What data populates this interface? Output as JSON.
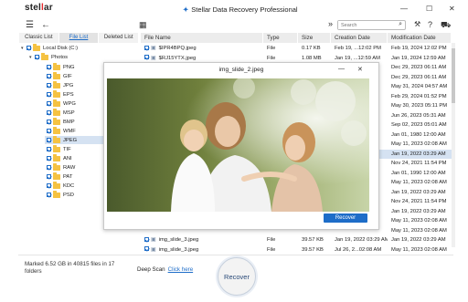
{
  "app": {
    "logo_text": "stellar",
    "title": "Stellar Data Recovery Professional",
    "window_controls": [
      "—",
      "☐",
      "✕"
    ]
  },
  "toolbar": {
    "menu_icon": "hamburger-icon",
    "back_icon": "back-arrow-icon",
    "view_icon": "grid-view-icon",
    "expand_icon": "double-chevron-icon",
    "search_placeholder": "Search",
    "right_icons": [
      "magnifier-icon",
      "wrench-icon",
      "help-icon",
      "cart-icon"
    ]
  },
  "left_tabs": [
    "Classic List",
    "File List",
    "Deleted List"
  ],
  "active_tab": "File List",
  "tree": [
    {
      "label": "Local Disk (C:)",
      "level": 0,
      "type": "drive"
    },
    {
      "label": "Photos",
      "level": 1,
      "type": "folder"
    },
    {
      "label": "PNG",
      "level": 2
    },
    {
      "label": "GIF",
      "level": 2
    },
    {
      "label": "JPG",
      "level": 2
    },
    {
      "label": "EPS",
      "level": 2
    },
    {
      "label": "WPG",
      "level": 2
    },
    {
      "label": "MSP",
      "level": 2
    },
    {
      "label": "BMP",
      "level": 2
    },
    {
      "label": "WMF",
      "level": 2
    },
    {
      "label": "JPEG",
      "level": 2,
      "selected": true
    },
    {
      "label": "TIF",
      "level": 2
    },
    {
      "label": "ANI",
      "level": 2
    },
    {
      "label": "RAW",
      "level": 2
    },
    {
      "label": "PAT",
      "level": 2
    },
    {
      "label": "KDC",
      "level": 2
    },
    {
      "label": "PSD",
      "level": 2
    }
  ],
  "table": {
    "columns": [
      "File Name",
      "Type",
      "Size",
      "Creation Date",
      "Modification Date"
    ],
    "rows": [
      {
        "name": "$IPR4BPQ.jpeg",
        "type": "File",
        "size": "0.17 KB",
        "created": "Feb 19, ...12:02 PM",
        "modified": "Feb 19, 2024 12:02 PM"
      },
      {
        "name": "$RJ15YTX.jpeg",
        "type": "File",
        "size": "1.08 MB",
        "created": "Jan 19, ...12:59 AM",
        "modified": "Jan 19, 2024 12:59 AM"
      },
      {
        "name": "",
        "type": "",
        "size": "",
        "created": "",
        "modified": "Dec 29, 2023 06:11 AM"
      },
      {
        "name": "",
        "type": "",
        "size": "",
        "created": "",
        "modified": "Dec 29, 2023 06:11 AM"
      },
      {
        "name": "",
        "type": "",
        "size": "",
        "created": "",
        "modified": "May 31, 2024 04:57 AM"
      },
      {
        "name": "",
        "type": "",
        "size": "",
        "created": "",
        "modified": "Feb 29, 2024 01:52 PM"
      },
      {
        "name": "",
        "type": "",
        "size": "",
        "created": "",
        "modified": "May 30, 2023 05:11 PM"
      },
      {
        "name": "",
        "type": "",
        "size": "",
        "created": "",
        "modified": "Jun 26, 2023 05:31 AM"
      },
      {
        "name": "",
        "type": "",
        "size": "",
        "created": "",
        "modified": "Sep 02, 2023 05:01 AM"
      },
      {
        "name": "",
        "type": "",
        "size": "",
        "created": "",
        "modified": "Jan 01, 1980 12:00 AM"
      },
      {
        "name": "",
        "type": "",
        "size": "",
        "created": "",
        "modified": "May 11, 2023 02:08 AM"
      },
      {
        "name": "",
        "type": "",
        "size": "",
        "created": "",
        "modified": "Jan 19, 2022 03:29 AM"
      },
      {
        "name": "",
        "type": "",
        "size": "",
        "created": "",
        "modified": "Nov 24, 2021 11:54 PM"
      },
      {
        "name": "",
        "type": "",
        "size": "",
        "created": "",
        "modified": "Jan 01, 1990 12:00 AM"
      },
      {
        "name": "",
        "type": "",
        "size": "",
        "created": "",
        "modified": "May 11, 2023 02:08 AM"
      },
      {
        "name": "",
        "type": "",
        "size": "",
        "created": "",
        "modified": "Jan 19, 2022 03:29 AM"
      },
      {
        "name": "",
        "type": "",
        "size": "",
        "created": "",
        "modified": "Nov 24, 2021 11:54 PM"
      },
      {
        "name": "",
        "type": "",
        "size": "",
        "created": "",
        "modified": "Jan 19, 2022 03:29 AM"
      },
      {
        "name": "",
        "type": "",
        "size": "",
        "created": "",
        "modified": "May 11, 2023 02:08 AM"
      },
      {
        "name": "",
        "type": "",
        "size": "",
        "created": "",
        "modified": "May 11, 2023 02:08 AM"
      },
      {
        "name": "img_slide_3.jpeg",
        "type": "File",
        "size": "39.57 KB",
        "created": "Jan 19, 2022 03:29 AM",
        "modified": "Jan 19, 2022 03:29 AM"
      },
      {
        "name": "img_slide_3.jpeg",
        "type": "File",
        "size": "39.57 KB",
        "created": "Jul 26, 2...02:08 AM",
        "modified": "May 11, 2023 02:08 AM"
      }
    ],
    "partial_am_labels": [
      "AM",
      "AM",
      "AM",
      "AM",
      "AM",
      "AM",
      "AM",
      "AM",
      "AM",
      "AM",
      "AM",
      "AM",
      "AM"
    ]
  },
  "preview": {
    "title": "img_slide_2.jpeg",
    "recover_label": "Recover",
    "image": "photo-mother-two-daughters"
  },
  "status": {
    "marked": "Marked 6.52 GB in 40815 files in 17 folders",
    "deep_scan_label": "Deep Scan",
    "deep_scan_link": "Click here",
    "recover_label": "Recover"
  },
  "colors": {
    "accent": "#1e6dc8",
    "logo_red": "#e5262a",
    "folder": "#f5c242",
    "selection": "#d5e2f2"
  }
}
